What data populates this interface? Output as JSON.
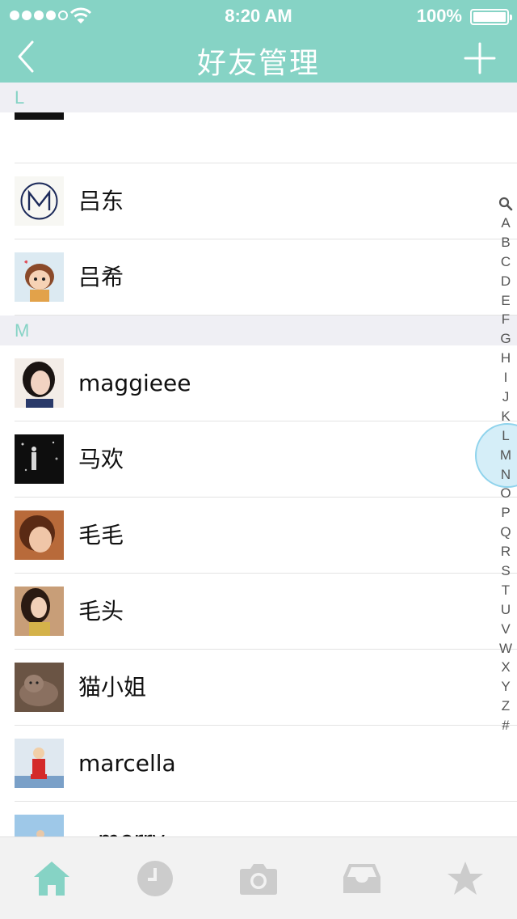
{
  "status_bar": {
    "time": "8:20 AM",
    "battery": "100%"
  },
  "header": {
    "title": "好友管理",
    "back_icon": "chevron-left-icon",
    "add_icon": "plus-icon"
  },
  "sections": [
    {
      "letter": "L",
      "rows": [
        {
          "name": "吕东",
          "avatar": "logo-m"
        },
        {
          "name": "吕希",
          "avatar": "cartoon-girl"
        }
      ]
    },
    {
      "letter": "M",
      "rows": [
        {
          "name": "maggieee"
        },
        {
          "name": "马欢"
        },
        {
          "name": "毛毛"
        },
        {
          "name": "毛头"
        },
        {
          "name": "猫小姐"
        },
        {
          "name": "marcella"
        },
        {
          "name": "merry"
        }
      ]
    }
  ],
  "index": [
    "A",
    "B",
    "C",
    "D",
    "E",
    "F",
    "G",
    "H",
    "I",
    "J",
    "K",
    "L",
    "M",
    "N",
    "O",
    "P",
    "Q",
    "R",
    "S",
    "T",
    "U",
    "V",
    "W",
    "X",
    "Y",
    "Z",
    "#"
  ],
  "index_active": "M",
  "tabs": [
    {
      "icon": "home-icon",
      "active": true
    },
    {
      "icon": "clock-icon",
      "active": false
    },
    {
      "icon": "camera-icon",
      "active": false
    },
    {
      "icon": "inbox-icon",
      "active": false
    },
    {
      "icon": "star-icon",
      "active": false
    }
  ],
  "colors": {
    "accent": "#86d3c5",
    "section_bg": "#efeff4",
    "tab_inactive": "#cccccc"
  }
}
